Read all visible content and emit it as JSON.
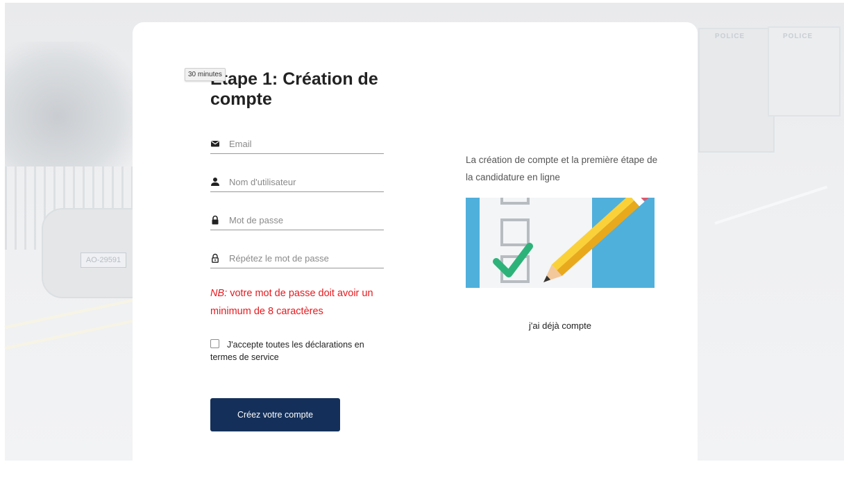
{
  "tooltip": "30 minutes",
  "form": {
    "title": "Etape 1: Création de compte",
    "fields": [
      {
        "name": "email",
        "icon": "envelope-icon",
        "placeholder": "Email",
        "value": ""
      },
      {
        "name": "username",
        "icon": "user-icon",
        "placeholder": "Nom d'utilisateur",
        "value": ""
      },
      {
        "name": "password",
        "icon": "lock-icon",
        "placeholder": "Mot de passe",
        "value": ""
      },
      {
        "name": "password-repeat",
        "icon": "lock-outline-icon",
        "placeholder": "Répétez le mot de passe",
        "value": ""
      }
    ],
    "note_prefix": "NB:",
    "note_text": " votre mot de passe doit avoir un minimum de 8 caractères",
    "terms_label": "J'accepte toutes les déclarations en termes de service",
    "terms_checked": false,
    "submit_label": "Créez votre compte"
  },
  "side": {
    "description": "La création de compte et la première étape de la candidature en ligne",
    "login_link": "j'ai déjà compte"
  },
  "background": {
    "plate": "AO-29591",
    "truck_label": "POLICE"
  },
  "colors": {
    "primary_button": "#14305a",
    "warning_text": "#e6191e",
    "illustration_blue": "#4fb0dc",
    "check_green": "#2db37a",
    "pencil_yellow": "#f7c325"
  }
}
